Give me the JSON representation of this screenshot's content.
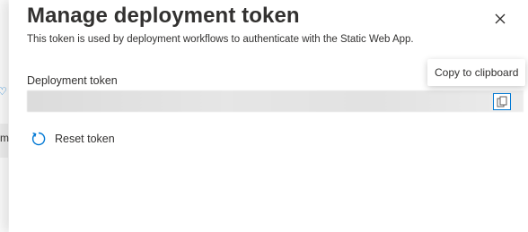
{
  "background": {
    "partial_glyph_top": "♡",
    "partial_text_mid": "m"
  },
  "panel": {
    "title": "Manage deployment token",
    "subtitle": "This token is used by deployment workflows to authenticate with the Static Web App.",
    "close_icon": "close-icon",
    "token_field": {
      "label": "Deployment token",
      "value": ""
    },
    "copy_button": {
      "icon": "copy-icon",
      "tooltip": "Copy to clipboard"
    },
    "reset_button": {
      "icon": "refresh-icon",
      "label": "Reset token"
    }
  },
  "colors": {
    "accent": "#0078d4",
    "text": "#323130"
  }
}
